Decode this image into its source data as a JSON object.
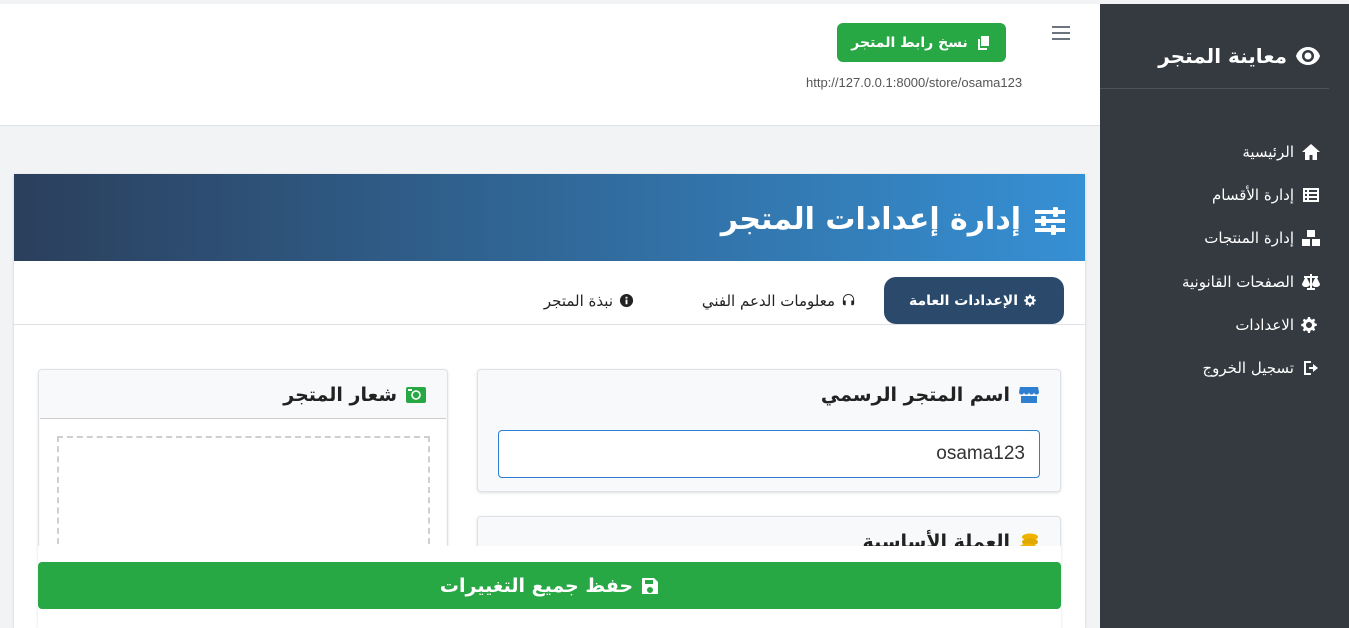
{
  "sidebar": {
    "brand": "معاينة المتجر",
    "items": [
      {
        "label": "الرئيسية",
        "icon": "home-icon"
      },
      {
        "label": "إدارة الأقسام",
        "icon": "list-icon"
      },
      {
        "label": "إدارة المنتجات",
        "icon": "boxes-icon"
      },
      {
        "label": "الصفحات القانونية",
        "icon": "balance-scale-icon"
      },
      {
        "label": "الاعدادات",
        "icon": "cogs-icon"
      },
      {
        "label": "تسجيل الخروج",
        "icon": "sign-out-icon"
      }
    ]
  },
  "header": {
    "copy_label": "نسخ رابط المتجر",
    "store_url": "http://127.0.0.1:8000/store/osama123"
  },
  "page": {
    "title": "إدارة إعدادات المتجر"
  },
  "tabs": [
    {
      "label": "الإعدادات العامة",
      "active": true
    },
    {
      "label": "معلومات الدعم الفني",
      "active": false
    },
    {
      "label": "نبذة المتجر",
      "active": false
    }
  ],
  "store_name": {
    "label": "اسم المتجر الرسمي",
    "value": "osama123"
  },
  "store_logo": {
    "label": "شعار المتجر"
  },
  "currency": {
    "label": "العملة الأساسية"
  },
  "save": {
    "label": "حفظ جميع التغييرات"
  },
  "colors": {
    "sidebar": "#343a40",
    "success": "#28a745",
    "header_gradient_start": "#2b3f5c",
    "header_gradient_end": "#3690d4",
    "active_tab": "#2b4a6b"
  }
}
